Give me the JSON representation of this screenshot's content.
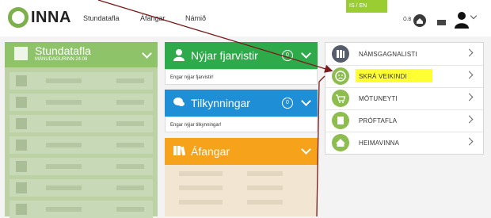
{
  "header": {
    "logo_text": "INNA",
    "nav": [
      "Stundatafla",
      "Áfangar",
      "Námið"
    ],
    "lang_toggle": "IS / EN",
    "ob_label": "Ó.B",
    "icons": [
      "home-icon",
      "mail-icon",
      "user-icon"
    ]
  },
  "left_panel": {
    "title": "Stundatafla",
    "subtitle": "MÁNUDAGURINN 24.08"
  },
  "cards": {
    "news": {
      "title": "Nýjar fjarvistir",
      "count": "0",
      "empty_text": "Engar nýjar fjarvistir!",
      "color": "#2eaa4a"
    },
    "announcements": {
      "title": "Tilkynningar",
      "count": "0",
      "empty_text": "Engar nýjar tilkynningar!",
      "color": "#1e8fd6"
    },
    "courses": {
      "title": "Áfangar",
      "color": "#f7a21b"
    }
  },
  "quick_menu": {
    "items": [
      {
        "label": "NÁMSGAGNALISTI",
        "icon": "books-icon",
        "color": "#555c6b"
      },
      {
        "label": "SKRÁ VEIKINDI",
        "icon": "sad-face-icon",
        "color": "#8dbd4e"
      },
      {
        "label": "MÖTUNEYTI",
        "icon": "cart-icon",
        "color": "#8dbd4e"
      },
      {
        "label": "PRÓFTAFLA",
        "icon": "book-icon",
        "color": "#8dbd4e"
      },
      {
        "label": "HEIMAVINNA",
        "icon": "home-icon",
        "color": "#8dbd4e"
      }
    ]
  },
  "colors": {
    "accent_green": "#8ec36a",
    "highlight": "#ffff33",
    "arrow": "#7a1a1a"
  }
}
